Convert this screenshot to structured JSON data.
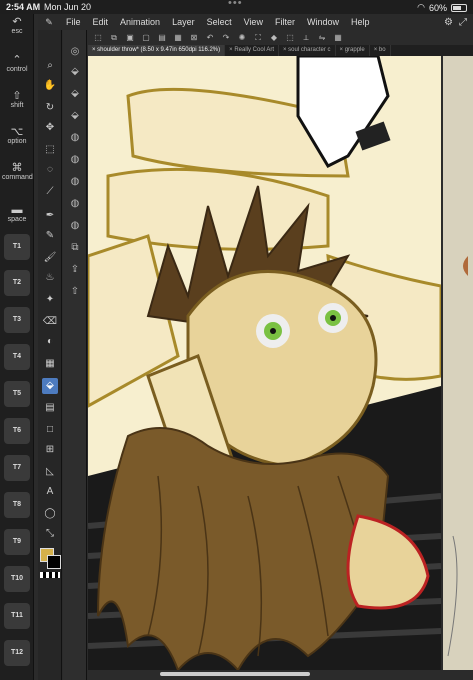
{
  "status": {
    "time": "2:54 AM",
    "date": "Mon Jun 20",
    "battery": "60%"
  },
  "menu": {
    "items": [
      "File",
      "Edit",
      "Animation",
      "Layer",
      "Select",
      "View",
      "Filter",
      "Window",
      "Help"
    ]
  },
  "left": {
    "esc": "esc",
    "control": "control",
    "shift": "shift",
    "option": "option",
    "command": "command",
    "space": "space",
    "tkeys": [
      "T1",
      "T2",
      "T3",
      "T4",
      "T5",
      "T6",
      "T7",
      "T8",
      "T9",
      "T10",
      "T11",
      "T12"
    ]
  },
  "tabs": [
    {
      "label": "shoulder throw* (8.50 x 9.47in 650dpi 116.2%)"
    },
    {
      "label": "Really Cool Art"
    },
    {
      "label": "soul character c"
    },
    {
      "label": "grapple"
    },
    {
      "label": "bo"
    }
  ],
  "colors": {
    "main": "#d4b04a",
    "sub": "#000000",
    "canvas_bg": "#f7efcf",
    "outline": "#a88a2a"
  }
}
